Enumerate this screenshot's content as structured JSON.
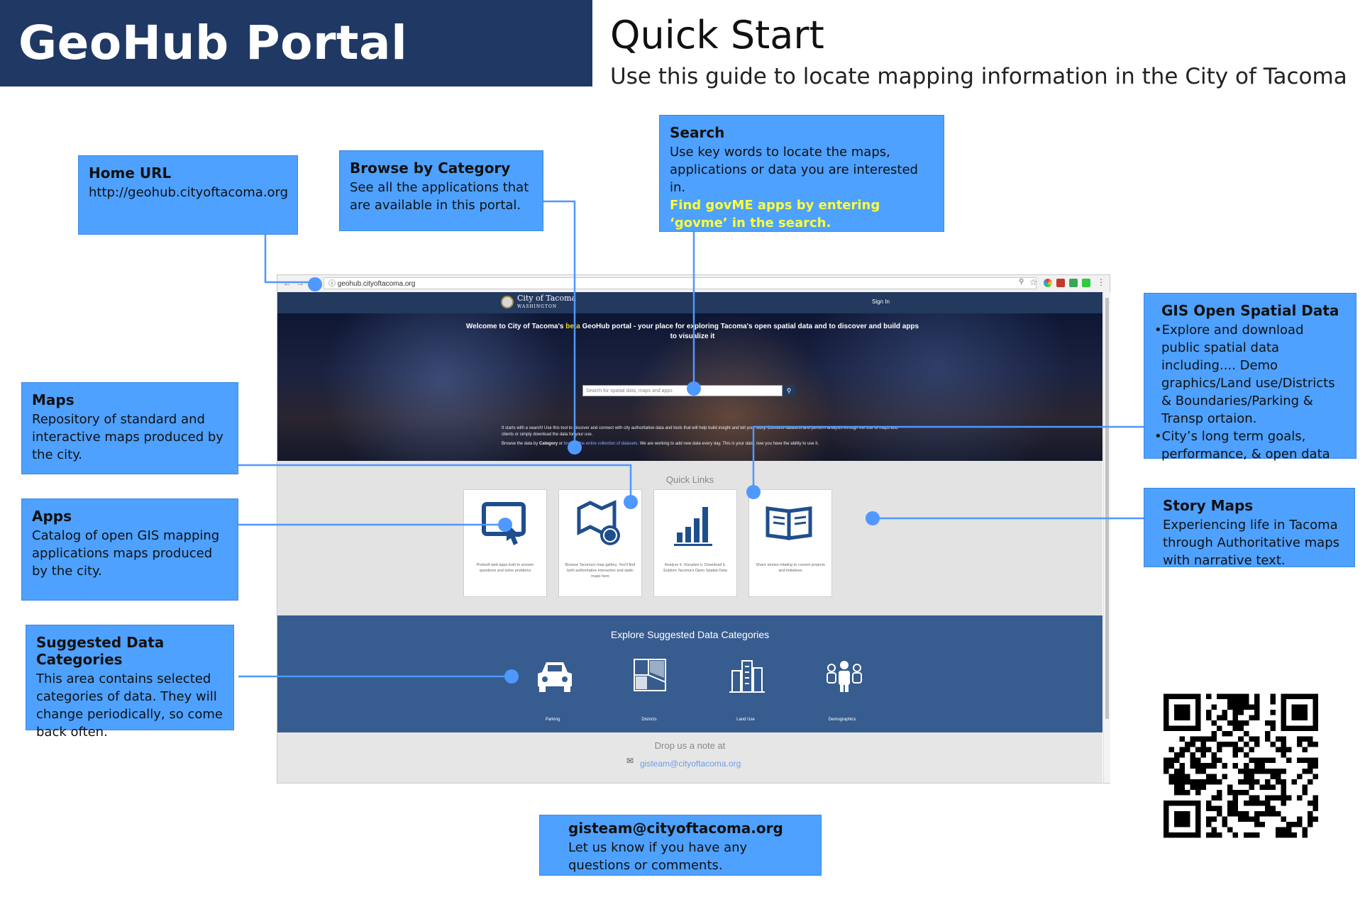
{
  "header": {
    "title": "GeoHub Portal",
    "quick_start": "Quick Start",
    "subtitle": "Use this guide to locate mapping information in the City of Tacoma"
  },
  "callouts": {
    "home_url": {
      "title": "Home URL",
      "body": "http://geohub.cityoftacoma.org"
    },
    "browse": {
      "title": "Browse by Category",
      "body": "See all the applications that are available in this portal."
    },
    "search": {
      "title": "Search",
      "body": "Use key words to locate the maps, applications or data you are interested in.",
      "highlight": "Find govME apps by entering ‘govme’ in the search."
    },
    "gis_open": {
      "title": "GIS Open Spatial Data",
      "items": [
        "Explore and download public spatial data including.... Demo graphics/Land use/Districts & Boundaries/Parking & Transp ortaion.",
        "City’s long term goals, performance, & open data"
      ]
    },
    "maps": {
      "title": "Maps",
      "body": "Repository of standard and interactive maps produced by the city."
    },
    "apps": {
      "title": "Apps",
      "body": "Catalog of open GIS mapping applications maps produced by the city."
    },
    "story_maps": {
      "title": "Story Maps",
      "body": "Experiencing life in Tacoma through Authoritative maps with narrative text."
    },
    "suggested": {
      "title": "Suggested Data Categories",
      "body": "This area contains selected categories of data. They will change periodically, so come back often."
    },
    "contact": {
      "title": "gisteam@cityoftacoma.org",
      "body": "Let us know if you have any questions or comments."
    }
  },
  "browser": {
    "url": "geohub.cityoftacoma.org",
    "site": {
      "logo_name": "City of Tacoma",
      "logo_sub": "WASHINGTON",
      "sign_in": "Sign In",
      "welcome_before": "Welcome to City of Tacoma's",
      "welcome_beta": "beta",
      "welcome_after": "GeoHub portal - your place for exploring Tacoma's open spatial data and to discover and build apps to visualize it",
      "search_placeholder": "Search for spatial data, maps and apps",
      "hero_text_1": "It starts with a search! Use this tool to discover and connect with city authoritative data and tools that will help build insight and tell your story. Combine datasets and perform analysis through the use of maps and clients or simply download the data for your use.",
      "hero_text_2_a": "Browse the data by",
      "hero_text_2_b": "Category",
      "hero_text_2_c": "or",
      "hero_text_2_link": "browse the entire collection of datasets.",
      "hero_text_2_d": "We are working to add new data every day. This is your data, now you have the ability to use it.",
      "quick_links_title": "Quick Links",
      "cards": [
        {
          "icon": "tablet-touch-icon",
          "caption": "Prebuilt web apps built to answer questions and solve problems"
        },
        {
          "icon": "map-globe-icon",
          "caption": "Browse Tacoma's map gallery. You'll find both authoritative interactive and static maps here"
        },
        {
          "icon": "bar-chart-icon",
          "caption": "Analyze it. Visualize it. Download it. Explore Tacoma's Open Spatial Data"
        },
        {
          "icon": "open-book-icon",
          "caption": "Share stories relating to current projects and initiatives"
        }
      ],
      "explore_title": "Explore Suggested Data Categories",
      "categories": [
        {
          "icon": "car-icon",
          "label": "Parking"
        },
        {
          "icon": "districts-map-icon",
          "label": "Districts"
        },
        {
          "icon": "buildings-icon",
          "label": "Land Use"
        },
        {
          "icon": "people-icon",
          "label": "Demographics"
        }
      ],
      "drop_note": "Drop us a note at",
      "email": "gisteam@cityoftacoma.org"
    }
  },
  "colors": {
    "title_bar": "#1f3864",
    "callout": "#4ea1ff",
    "site_nav": "#23395e",
    "explore_bg": "#375c8f",
    "card_icon": "#1f4e8c",
    "highlight": "#ffff3b"
  }
}
